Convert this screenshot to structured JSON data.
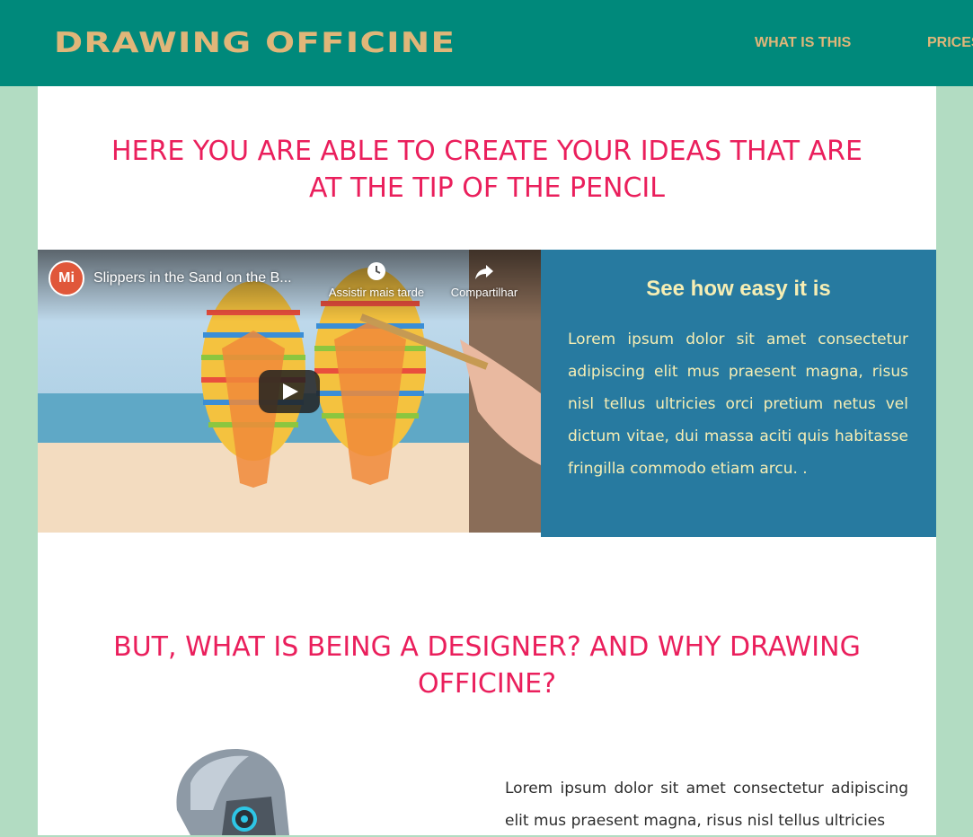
{
  "header": {
    "logo": "DRAWING OFFICINE",
    "nav": [
      "WHAT IS THIS",
      "PRICES"
    ]
  },
  "hero": {
    "headline": "HERE YOU ARE ABLE TO CREATE YOUR IDEAS THAT ARE AT THE TIP OF THE PENCIL"
  },
  "video": {
    "title": "Slippers in the Sand on the B...",
    "watch_later": "Assistir mais tarde",
    "share": "Compartilhar",
    "channel_initials": "Mi"
  },
  "feature": {
    "title": "See how easy it is",
    "body": "Lorem ipsum dolor sit amet consectetur adipiscing elit mus praesent magna, risus nisl tellus ultricies orci pretium netus vel dictum vitae, dui massa aciti quis habitasse fringilla commodo etiam arcu. ."
  },
  "section2": {
    "headline": "BUT, WHAT IS BEING A DESIGNER? AND WHY DRAWING OFFICINE?",
    "body": "Lorem ipsum dolor sit amet consectetur adipiscing elit mus praesent magna, risus nisl tellus ultricies"
  },
  "colors": {
    "header_bg": "#00897b",
    "logo": "#e0b679",
    "headline": "#ea1f5c",
    "feature_bg": "#277aa0",
    "feature_text": "#f6eeb4",
    "page_bg": "#b2dcc2"
  }
}
